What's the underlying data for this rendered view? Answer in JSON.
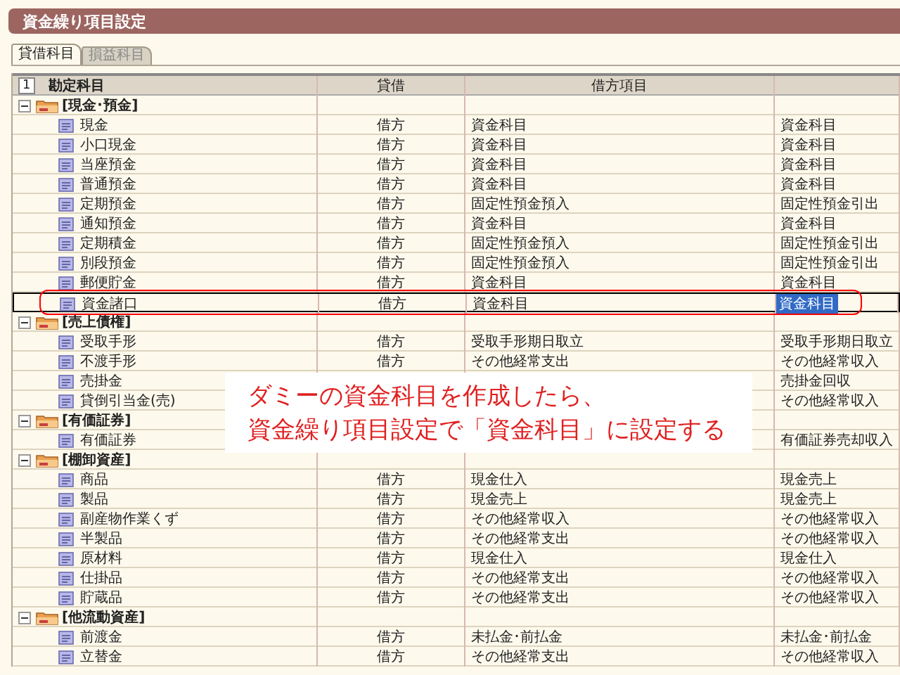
{
  "window": {
    "title": "資金繰り項目設定"
  },
  "tabs": [
    {
      "label": "貸借科目",
      "selected": true
    },
    {
      "label": "損益科目",
      "selected": false
    }
  ],
  "table": {
    "row_number": "1",
    "columns": [
      "勘定科目",
      "貸借",
      "借方項目"
    ],
    "groups": [
      {
        "name": "[現金･預金]",
        "expanded": true,
        "items": [
          {
            "name": "現金",
            "side": "借方",
            "debit_item": "資金科目",
            "column_4": "資金科目",
            "selected": false
          },
          {
            "name": "小口現金",
            "side": "借方",
            "debit_item": "資金科目",
            "column_4": "資金科目",
            "selected": false
          },
          {
            "name": "当座預金",
            "side": "借方",
            "debit_item": "資金科目",
            "column_4": "資金科目",
            "selected": false
          },
          {
            "name": "普通預金",
            "side": "借方",
            "debit_item": "資金科目",
            "column_4": "資金科目",
            "selected": false
          },
          {
            "name": "定期預金",
            "side": "借方",
            "debit_item": "固定性預金預入",
            "column_4": "固定性預金引出",
            "selected": false
          },
          {
            "name": "通知預金",
            "side": "借方",
            "debit_item": "資金科目",
            "column_4": "資金科目",
            "selected": false
          },
          {
            "name": "定期積金",
            "side": "借方",
            "debit_item": "固定性預金預入",
            "column_4": "固定性預金引出",
            "selected": false
          },
          {
            "name": "別段預金",
            "side": "借方",
            "debit_item": "固定性預金預入",
            "column_4": "固定性預金引出",
            "selected": false
          },
          {
            "name": "郵便貯金",
            "side": "借方",
            "debit_item": "資金科目",
            "column_4": "資金科目",
            "selected": false
          },
          {
            "name": "資金諸口",
            "side": "借方",
            "debit_item": "資金科目",
            "column_4": "資金科目",
            "selected": true
          }
        ]
      },
      {
        "name": "[売上債権]",
        "expanded": true,
        "items": [
          {
            "name": "受取手形",
            "side": "借方",
            "debit_item": "受取手形期日取立",
            "column_4": "受取手形期日取立",
            "selected": false
          },
          {
            "name": "不渡手形",
            "side": "借方",
            "debit_item": "その他経常支出",
            "column_4": "その他経常収入",
            "selected": false
          },
          {
            "name": "売掛金",
            "column_4": "売掛金回収",
            "selected": false
          },
          {
            "name": "貸倒引当金(売)",
            "column_4": "その他経常収入",
            "selected": false
          }
        ]
      },
      {
        "name": "[有価証券]",
        "expanded": true,
        "items": [
          {
            "name": "有価証券",
            "column_4": "有価証券売却収入",
            "selected": false
          }
        ]
      },
      {
        "name": "[棚卸資産]",
        "expanded": true,
        "items": [
          {
            "name": "商品",
            "side": "借方",
            "debit_item": "現金仕入",
            "column_4": "現金売上",
            "selected": false
          },
          {
            "name": "製品",
            "side": "借方",
            "debit_item": "現金売上",
            "column_4": "現金売上",
            "selected": false
          },
          {
            "name": "副産物作業くず",
            "side": "借方",
            "debit_item": "その他経常収入",
            "column_4": "その他経常収入",
            "selected": false
          },
          {
            "name": "半製品",
            "side": "借方",
            "debit_item": "その他経常支出",
            "column_4": "その他経常収入",
            "selected": false
          },
          {
            "name": "原材料",
            "side": "借方",
            "debit_item": "現金仕入",
            "column_4": "現金仕入",
            "selected": false
          },
          {
            "name": "仕掛品",
            "side": "借方",
            "debit_item": "その他経常支出",
            "column_4": "その他経常収入",
            "selected": false
          },
          {
            "name": "貯蔵品",
            "side": "借方",
            "debit_item": "その他経常支出",
            "column_4": "その他経常収入",
            "selected": false
          }
        ]
      },
      {
        "name": "[他流動資産]",
        "expanded": true,
        "items": [
          {
            "name": "前渡金",
            "side": "借方",
            "debit_item": "未払金･前払金",
            "column_4": "未払金･前払金",
            "selected": false
          },
          {
            "name": "立替金",
            "side": "借方",
            "debit_item": "その他経常支出",
            "column_4": "その他経常収入",
            "selected": false
          }
        ]
      }
    ]
  },
  "callout": {
    "lines": [
      "ダミーの資金科目を作成したら、",
      "資金繰り項目設定で「資金科目」に設定する"
    ]
  }
}
